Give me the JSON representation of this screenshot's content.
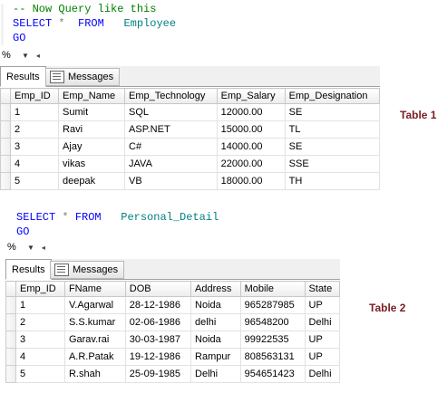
{
  "query1": {
    "comment": "-- Now Query like this",
    "select_kw": "SELECT",
    "star": "*",
    "from_kw": "FROM",
    "table": "Employee",
    "go": "GO"
  },
  "query2": {
    "select_kw": "SELECT",
    "star": "*",
    "from_kw": "FROM",
    "table": "Personal_Detail",
    "go": "GO"
  },
  "zoom": {
    "value": "%",
    "dropdown_icon": "chevron-down-icon",
    "scroll_icon": "arrow-left-icon"
  },
  "tabs": {
    "results": "Results",
    "messages": "Messages"
  },
  "table1": {
    "columns": [
      "Emp_ID",
      "Emp_Name",
      "Emp_Technology",
      "Emp_Salary",
      "Emp_Designation"
    ],
    "rows": [
      [
        "1",
        "Sumit",
        "SQL",
        "12000.00",
        "SE"
      ],
      [
        "2",
        "Ravi",
        "ASP.NET",
        "15000.00",
        "TL"
      ],
      [
        "3",
        "Ajay",
        "C#",
        "14000.00",
        "SE"
      ],
      [
        "4",
        "vikas",
        "JAVA",
        "22000.00",
        "SSE"
      ],
      [
        "5",
        "deepak",
        "VB",
        "18000.00",
        "TH"
      ]
    ],
    "caption": "Table 1"
  },
  "table2": {
    "columns": [
      "Emp_ID",
      "FName",
      "DOB",
      "Address",
      "Mobile",
      "State"
    ],
    "rows": [
      [
        "1",
        "V.Agarwal",
        "28-12-1986",
        "Noida",
        "965287985",
        "UP"
      ],
      [
        "2",
        "S.S.kumar",
        "02-06-1986",
        "delhi",
        "96548200",
        "Delhi"
      ],
      [
        "3",
        "Garav.rai",
        "30-03-1987",
        "Noida",
        "99922535",
        "UP"
      ],
      [
        "4",
        "A.R.Patak",
        "19-12-1986",
        "Rampur",
        "808563131",
        "UP"
      ],
      [
        "5",
        "R.shah",
        "25-09-1985",
        "Delhi",
        "954651423",
        "Delhi"
      ]
    ],
    "caption": "Table 2"
  },
  "colors": {
    "keyword": "#0000ff",
    "table_name": "#008080",
    "comment": "#008000",
    "caption": "#7b1c26"
  }
}
